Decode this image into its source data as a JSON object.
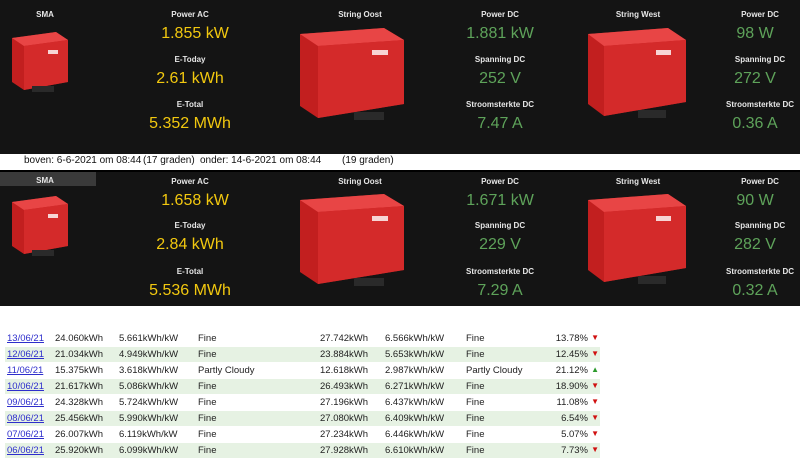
{
  "panels": [
    {
      "sma": {
        "title": "SMA",
        "power_ac_label": "Power AC",
        "power_ac": "1.855 kW",
        "etoday_label": "E-Today",
        "etoday": "2.61 kWh",
        "etotal_label": "E-Total",
        "etotal": "5.352 MWh"
      },
      "oost": {
        "title": "String Oost",
        "power_dc_label": "Power DC",
        "power_dc": "1.881 kW",
        "spanning_label": "Spanning DC",
        "spanning": "252 V",
        "stroom_label": "Stroomsterkte DC",
        "stroom": "7.47 A"
      },
      "west": {
        "title": "String West",
        "power_dc_label": "Power DC",
        "power_dc": "98 W",
        "spanning_label": "Spanning DC",
        "spanning": "272 V",
        "stroom_label": "Stroomsterkte DC",
        "stroom": "0.36 A"
      }
    },
    {
      "sma": {
        "title": "SMA",
        "power_ac_label": "Power AC",
        "power_ac": "1.658 kW",
        "etoday_label": "E-Today",
        "etoday": "2.84 kWh",
        "etotal_label": "E-Total",
        "etotal": "5.536 MWh"
      },
      "oost": {
        "title": "String Oost",
        "power_dc_label": "Power DC",
        "power_dc": "1.671 kW",
        "spanning_label": "Spanning DC",
        "spanning": "229 V",
        "stroom_label": "Stroomsterkte DC",
        "stroom": "7.29 A"
      },
      "west": {
        "title": "String West",
        "power_dc_label": "Power DC",
        "power_dc": "90 W",
        "spanning_label": "Spanning DC",
        "spanning": "282 V",
        "stroom_label": "Stroomsterkte DC",
        "stroom": "0.32 A"
      }
    }
  ],
  "notes": {
    "top": "boven: 6-6-2021 om 08:44",
    "top_temp": "(17 graden)",
    "bottom": "onder: 14-6-2021 om 08:44",
    "bottom_temp": "(19 graden)"
  },
  "colors": {
    "dashboard_bg": "#141414",
    "yellow": "#f2c80f",
    "green": "#5ea35a",
    "inverter_red": "#d42a2a",
    "row_alt": "#e6f2e3",
    "down": "#d01010",
    "up": "#2c9a2c"
  },
  "log": [
    {
      "date": "13/06/21",
      "kwh": "24.060kWh",
      "ratio": "5.661kWh/kW",
      "weather": "Fine",
      "kwh2": "27.742kWh",
      "ratio2": "6.566kWh/kW",
      "weather2": "Fine",
      "pct": "13.78%",
      "trend": "down",
      "arrow": "▼"
    },
    {
      "date": "12/06/21",
      "kwh": "21.034kWh",
      "ratio": "4.949kWh/kW",
      "weather": "Fine",
      "kwh2": "23.884kWh",
      "ratio2": "5.653kWh/kW",
      "weather2": "Fine",
      "pct": "12.45%",
      "trend": "down",
      "arrow": "▼"
    },
    {
      "date": "11/06/21",
      "kwh": "15.375kWh",
      "ratio": "3.618kWh/kW",
      "weather": "Partly Cloudy",
      "kwh2": "12.618kWh",
      "ratio2": "2.987kWh/kW",
      "weather2": "Partly Cloudy",
      "pct": "21.12%",
      "trend": "up",
      "arrow": "▲"
    },
    {
      "date": "10/06/21",
      "kwh": "21.617kWh",
      "ratio": "5.086kWh/kW",
      "weather": "Fine",
      "kwh2": "26.493kWh",
      "ratio2": "6.271kWh/kW",
      "weather2": "Fine",
      "pct": "18.90%",
      "trend": "down",
      "arrow": "▼"
    },
    {
      "date": "09/06/21",
      "kwh": "24.328kWh",
      "ratio": "5.724kWh/kW",
      "weather": "Fine",
      "kwh2": "27.196kWh",
      "ratio2": "6.437kWh/kW",
      "weather2": "Fine",
      "pct": "11.08%",
      "trend": "down",
      "arrow": "▼"
    },
    {
      "date": "08/06/21",
      "kwh": "25.456kWh",
      "ratio": "5.990kWh/kW",
      "weather": "Fine",
      "kwh2": "27.080kWh",
      "ratio2": "6.409kWh/kW",
      "weather2": "Fine",
      "pct": "6.54%",
      "trend": "down",
      "arrow": "▼"
    },
    {
      "date": "07/06/21",
      "kwh": "26.007kWh",
      "ratio": "6.119kWh/kW",
      "weather": "Fine",
      "kwh2": "27.234kWh",
      "ratio2": "6.446kWh/kW",
      "weather2": "Fine",
      "pct": "5.07%",
      "trend": "down",
      "arrow": "▼"
    },
    {
      "date": "06/06/21",
      "kwh": "25.920kWh",
      "ratio": "6.099kWh/kW",
      "weather": "Fine",
      "kwh2": "27.928kWh",
      "ratio2": "6.610kWh/kW",
      "weather2": "Fine",
      "pct": "7.73%",
      "trend": "down",
      "arrow": "▼"
    }
  ]
}
